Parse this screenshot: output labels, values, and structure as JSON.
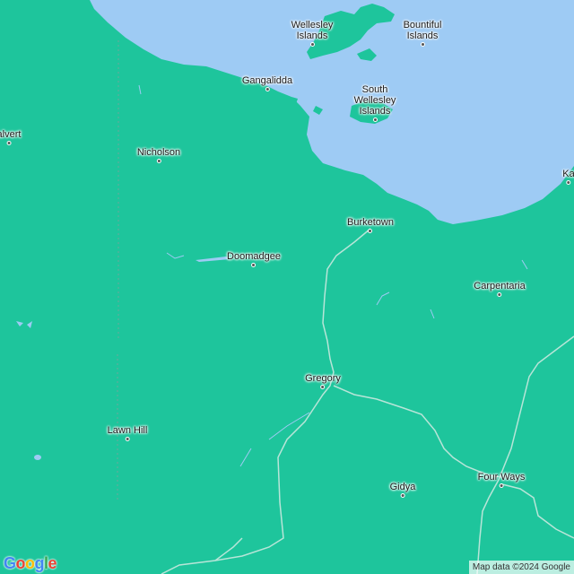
{
  "map": {
    "colors": {
      "land": "#1ec59c",
      "water": "#9ecbf4",
      "road": "#b8e5d8",
      "text": "#1a1a1a"
    },
    "places": [
      {
        "id": "wellesley-islands",
        "name": "Wellesley Islands"
      },
      {
        "id": "bountiful-islands",
        "name": "Bountiful Islands"
      },
      {
        "id": "gangalidda",
        "name": "Gangalidda"
      },
      {
        "id": "south-wellesley-islands",
        "name": "South Wellesley Islands"
      },
      {
        "id": "calvert",
        "name": "alvert"
      },
      {
        "id": "nicholson",
        "name": "Nicholson"
      },
      {
        "id": "ka",
        "name": "Ka"
      },
      {
        "id": "burketown",
        "name": "Burketown"
      },
      {
        "id": "doomadgee",
        "name": "Doomadgee"
      },
      {
        "id": "carpentaria",
        "name": "Carpentaria"
      },
      {
        "id": "gregory",
        "name": "Gregory"
      },
      {
        "id": "lawn-hill",
        "name": "Lawn Hill"
      },
      {
        "id": "four-ways",
        "name": "Four Ways"
      },
      {
        "id": "gidya",
        "name": "Gidya"
      }
    ],
    "attribution": "Map data ©2024 Google",
    "logo": "Google"
  }
}
